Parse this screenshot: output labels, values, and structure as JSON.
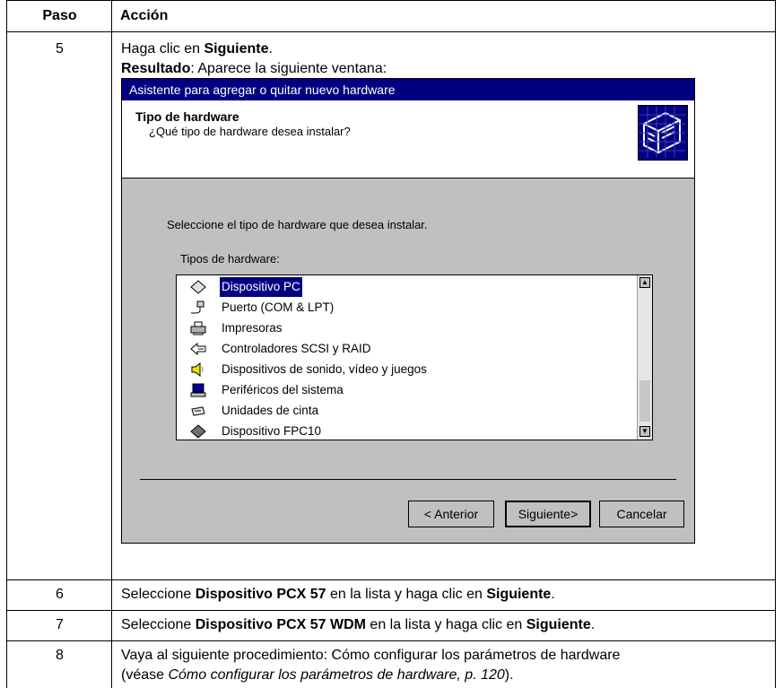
{
  "table": {
    "header": {
      "step": "Paso",
      "action": "Acción"
    },
    "rows": [
      {
        "step": "5",
        "line1": {
          "pre": "Haga clic en ",
          "bold": "Siguiente",
          "post": "."
        },
        "line2": {
          "bold": "Resultado",
          "post": ": Aparece la siguiente ventana:"
        }
      },
      {
        "step": "6",
        "pre": "Seleccione ",
        "bold1": "Dispositivo PCX 57",
        "mid": " en la lista y haga clic en ",
        "bold2": "Siguiente",
        "post": "."
      },
      {
        "step": "7",
        "pre": "Seleccione ",
        "bold1": "Dispositivo PCX 57 WDM",
        "mid": " en la lista y haga clic en ",
        "bold2": "Siguiente",
        "post": "."
      },
      {
        "step": "8",
        "line1": "Vaya al siguiente procedimiento: Cómo configurar los parámetros de hardware",
        "line2_pre": "(véase ",
        "line2_italic": "Cómo configurar los parámetros de hardware, p. 120",
        "line2_post": ")."
      }
    ]
  },
  "dialog": {
    "title": "Asistente para agregar o quitar nuevo hardware",
    "header_title": "Tipo de hardware",
    "header_subtitle": "¿Qué tipo de hardware desea instalar?",
    "description": "Seleccione el tipo de hardware que desea instalar.",
    "list_label": "Tipos de hardware:",
    "items": [
      {
        "label": "Dispositivo PC",
        "icon": "diamond-icon",
        "selected": true
      },
      {
        "label": "Puerto (COM & LPT)",
        "icon": "port-plug-icon",
        "selected": false
      },
      {
        "label": "Impresoras",
        "icon": "printer-icon",
        "selected": false
      },
      {
        "label": "Controladores SCSI y RAID",
        "icon": "scsi-icon",
        "selected": false
      },
      {
        "label": "Dispositivos de sonido, vídeo y juegos",
        "icon": "speaker-icon",
        "selected": false
      },
      {
        "label": "Periféricos del sistema",
        "icon": "computer-icon",
        "selected": false
      },
      {
        "label": "Unidades de cinta",
        "icon": "tape-drive-icon",
        "selected": false
      },
      {
        "label": "Dispositivo FPC10",
        "icon": "diamond-filled-icon",
        "selected": false
      }
    ],
    "buttons": {
      "back": "< Anterior",
      "next": "Siguiente>",
      "cancel": "Cancelar"
    },
    "colors": {
      "title_bar": "#000080",
      "face": "#c0c0c0",
      "selection": "#000080"
    }
  }
}
